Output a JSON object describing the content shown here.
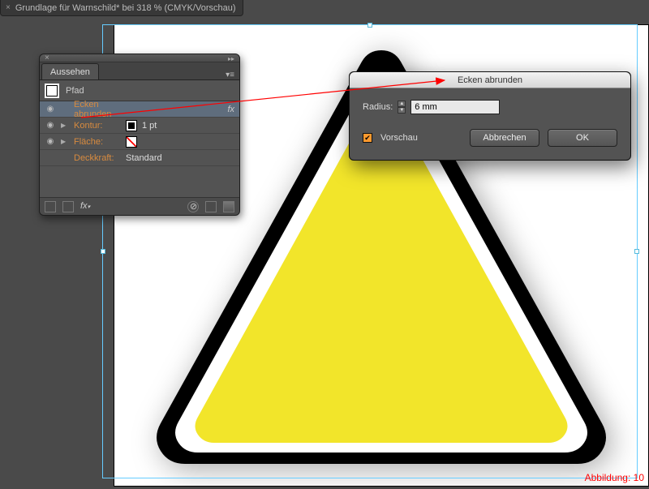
{
  "document": {
    "tab_label": "Grundlage für Warnschild* bei 318 % (CMYK/Vorschau)"
  },
  "appearance_panel": {
    "title": "Aussehen",
    "object_label": "Pfad",
    "rows": {
      "effect": "Ecken abrunden",
      "stroke_label": "Kontur:",
      "stroke_value": "1 pt",
      "fill_label": "Fläche:",
      "opacity_label": "Deckkraft:",
      "opacity_value": "Standard"
    },
    "fx_indicator": "fx"
  },
  "dialog": {
    "title": "Ecken abrunden",
    "radius_label": "Radius:",
    "radius_value": "6 mm",
    "preview_label": "Vorschau",
    "cancel": "Abbrechen",
    "ok": "OK"
  },
  "colors": {
    "triangle_fill": "#f2e52a",
    "triangle_stroke": "#000000",
    "selection": "#69c7ea"
  },
  "caption": "Abbildung: 10"
}
